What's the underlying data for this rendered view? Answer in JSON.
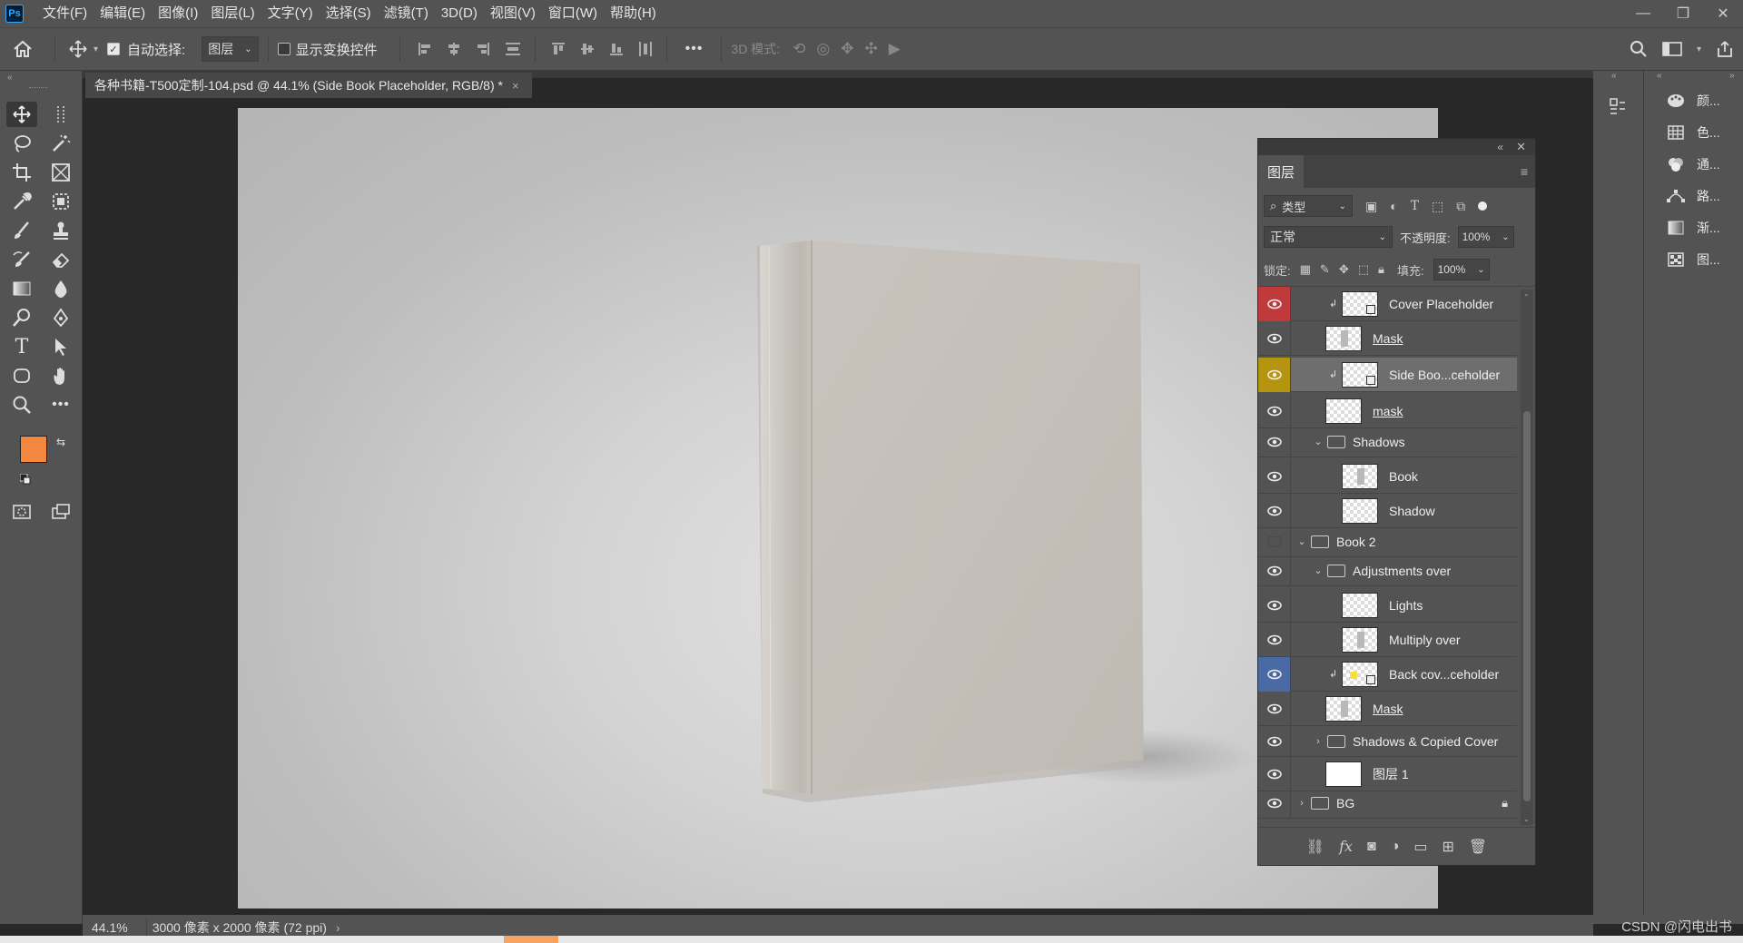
{
  "app": {
    "logo": "Ps"
  },
  "menu": [
    "文件(F)",
    "编辑(E)",
    "图像(I)",
    "图层(L)",
    "文字(Y)",
    "选择(S)",
    "滤镜(T)",
    "3D(D)",
    "视图(V)",
    "窗口(W)",
    "帮助(H)"
  ],
  "window_controls": {
    "minimize": "—",
    "restore": "❐",
    "close": "✕"
  },
  "options": {
    "auto_select_label": "自动选择:",
    "auto_select_checked": true,
    "auto_select_target": "图层",
    "show_transform_label": "显示变换控件",
    "show_transform_checked": false,
    "more": "•••",
    "mode_3d_label": "3D 模式:"
  },
  "document": {
    "tab_title": "各种书籍-T500定制-104.psd @ 44.1% (Side Book Placeholder, RGB/8) *",
    "close": "×"
  },
  "status": {
    "zoom": "44.1%",
    "doc_info": "3000 像素 x 2000 像素 (72 ppi)",
    "arrow": "›"
  },
  "colors": {
    "foreground": "#f3873f",
    "background": "#ffffff"
  },
  "watermark": "CSDN @闪电出书",
  "right_panel_items": [
    {
      "icon": "palette-icon",
      "label": "颜..."
    },
    {
      "icon": "swatches-icon",
      "label": "色..."
    },
    {
      "icon": "channels-icon",
      "label": "通..."
    },
    {
      "icon": "paths-icon",
      "label": "路..."
    },
    {
      "icon": "gradient-icon",
      "label": "渐..."
    },
    {
      "icon": "patterns-icon",
      "label": "图..."
    }
  ],
  "layers_panel": {
    "title": "图层",
    "filter_kind": "类型",
    "blend_mode": "正常",
    "opacity_label": "不透明度:",
    "opacity": "100%",
    "lock_label": "锁定:",
    "fill_label": "填充:",
    "fill": "100%",
    "layers": [
      {
        "name": "Cover Placeholder",
        "type": "smart",
        "indent": 2,
        "visible": true,
        "eye_color": "#c0393b",
        "clip": true,
        "underline": false,
        "selected": false
      },
      {
        "name": "Mask",
        "type": "layer",
        "indent": 1,
        "visible": true,
        "eye_color": "",
        "clip": false,
        "underline": true,
        "selected": false
      },
      {
        "name": "Side Boo...ceholder",
        "type": "smart",
        "indent": 2,
        "visible": true,
        "eye_color": "#b5950f",
        "clip": true,
        "underline": false,
        "selected": true
      },
      {
        "name": "mask",
        "type": "layer",
        "indent": 1,
        "visible": true,
        "eye_color": "",
        "clip": false,
        "underline": true,
        "selected": false
      },
      {
        "name": "Shadows",
        "type": "group-open",
        "indent": 1,
        "visible": true,
        "eye_color": "",
        "clip": false,
        "underline": false,
        "selected": false
      },
      {
        "name": "Book",
        "type": "layer",
        "indent": 2,
        "visible": true,
        "eye_color": "",
        "clip": false,
        "underline": false,
        "selected": false
      },
      {
        "name": "Shadow",
        "type": "layer",
        "indent": 2,
        "visible": true,
        "eye_color": "",
        "clip": false,
        "underline": false,
        "selected": false
      },
      {
        "name": "Book 2",
        "type": "group-open",
        "indent": 0,
        "visible": false,
        "eye_color": "",
        "clip": false,
        "underline": false,
        "selected": false
      },
      {
        "name": "Adjustments over",
        "type": "group-open",
        "indent": 1,
        "visible": true,
        "eye_color": "",
        "clip": false,
        "underline": false,
        "selected": false
      },
      {
        "name": "Lights",
        "type": "layer",
        "indent": 2,
        "visible": true,
        "eye_color": "",
        "clip": false,
        "underline": false,
        "selected": false
      },
      {
        "name": "Multiply over",
        "type": "layer",
        "indent": 2,
        "visible": true,
        "eye_color": "",
        "clip": false,
        "underline": false,
        "selected": false
      },
      {
        "name": "Back cov...ceholder",
        "type": "smart",
        "indent": 2,
        "visible": true,
        "eye_color": "#4a6aa5",
        "clip": true,
        "underline": false,
        "selected": false
      },
      {
        "name": "Mask",
        "type": "layer",
        "indent": 1,
        "visible": true,
        "eye_color": "",
        "clip": false,
        "underline": true,
        "selected": false
      },
      {
        "name": "Shadows & Copied Cover",
        "type": "group-closed",
        "indent": 1,
        "visible": true,
        "eye_color": "",
        "clip": false,
        "underline": false,
        "selected": false
      },
      {
        "name": "图层 1",
        "type": "white",
        "indent": 1,
        "visible": true,
        "eye_color": "",
        "clip": false,
        "underline": false,
        "selected": false
      },
      {
        "name": "BG",
        "type": "group-closed",
        "indent": 0,
        "visible": true,
        "eye_color": "",
        "clip": false,
        "underline": false,
        "selected": false,
        "locked": true
      }
    ],
    "footer_icons": [
      "link-icon",
      "fx-icon",
      "mask-icon",
      "adjustment-icon",
      "new-group-icon",
      "new-layer-icon",
      "trash-icon"
    ]
  }
}
